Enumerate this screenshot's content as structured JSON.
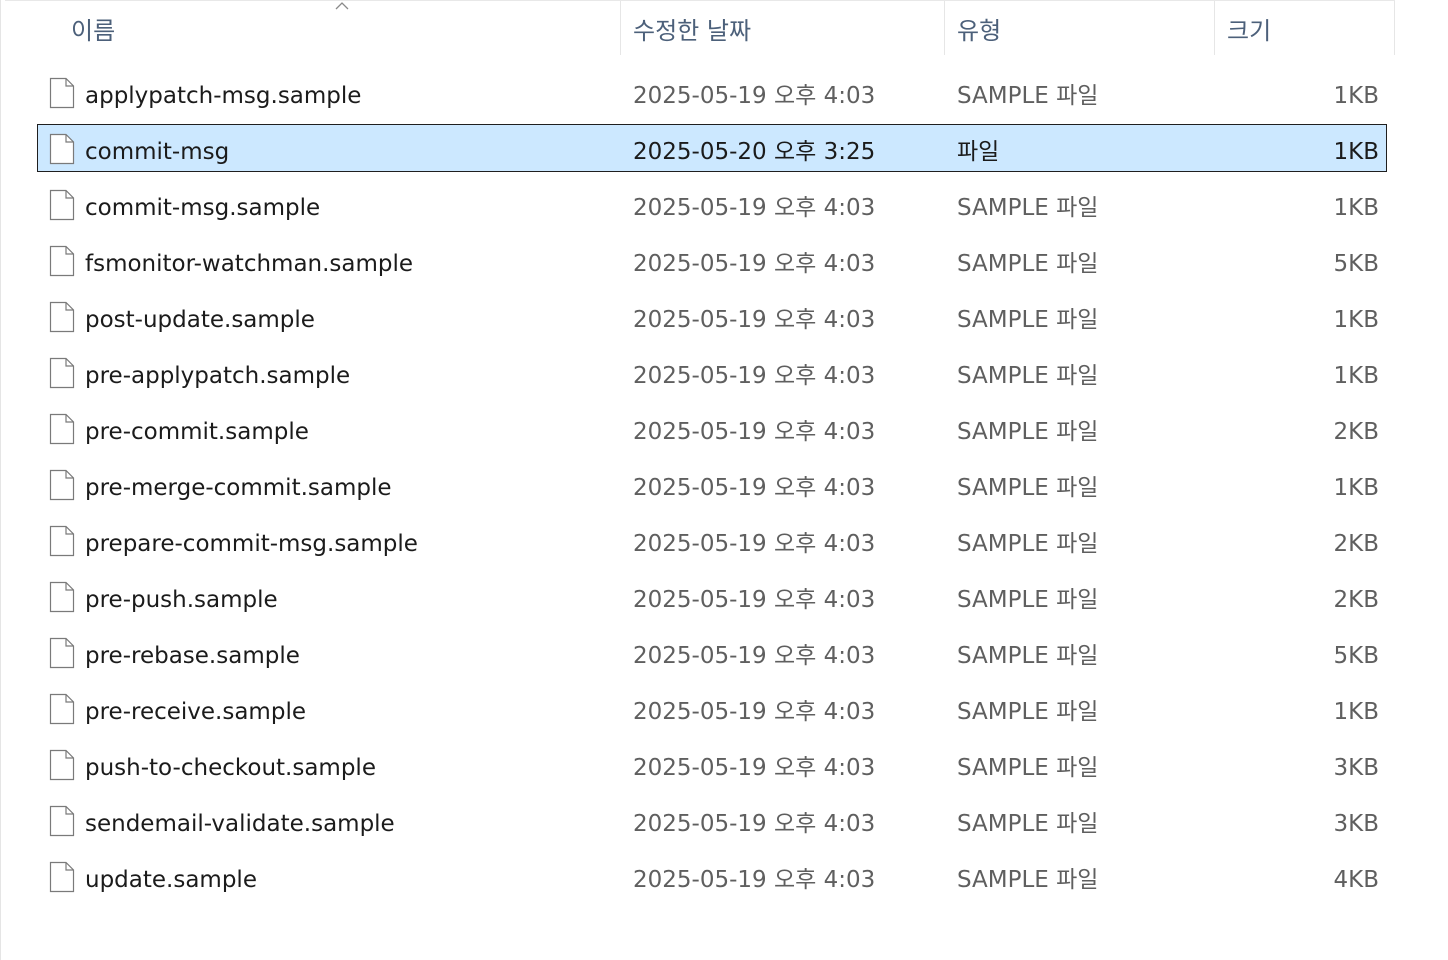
{
  "columns": {
    "name": "이름",
    "date": "수정한 날짜",
    "type": "유형",
    "size": "크기"
  },
  "sort": {
    "column": "name",
    "direction": "ascending"
  },
  "colors": {
    "selection": "#cce8ff",
    "header_text": "#4c607a"
  },
  "files": [
    {
      "name": "applypatch-msg.sample",
      "date": "2025-05-19 오후 4:03",
      "type": "SAMPLE 파일",
      "size": "1KB",
      "icon": "file-icon",
      "selected": false
    },
    {
      "name": "commit-msg",
      "date": "2025-05-20 오후 3:25",
      "type": "파일",
      "size": "1KB",
      "icon": "file-icon",
      "selected": true
    },
    {
      "name": "commit-msg.sample",
      "date": "2025-05-19 오후 4:03",
      "type": "SAMPLE 파일",
      "size": "1KB",
      "icon": "file-icon",
      "selected": false
    },
    {
      "name": "fsmonitor-watchman.sample",
      "date": "2025-05-19 오후 4:03",
      "type": "SAMPLE 파일",
      "size": "5KB",
      "icon": "file-icon",
      "selected": false
    },
    {
      "name": "post-update.sample",
      "date": "2025-05-19 오후 4:03",
      "type": "SAMPLE 파일",
      "size": "1KB",
      "icon": "file-icon",
      "selected": false
    },
    {
      "name": "pre-applypatch.sample",
      "date": "2025-05-19 오후 4:03",
      "type": "SAMPLE 파일",
      "size": "1KB",
      "icon": "file-icon",
      "selected": false
    },
    {
      "name": "pre-commit.sample",
      "date": "2025-05-19 오후 4:03",
      "type": "SAMPLE 파일",
      "size": "2KB",
      "icon": "file-icon",
      "selected": false
    },
    {
      "name": "pre-merge-commit.sample",
      "date": "2025-05-19 오후 4:03",
      "type": "SAMPLE 파일",
      "size": "1KB",
      "icon": "file-icon",
      "selected": false
    },
    {
      "name": "prepare-commit-msg.sample",
      "date": "2025-05-19 오후 4:03",
      "type": "SAMPLE 파일",
      "size": "2KB",
      "icon": "file-icon",
      "selected": false
    },
    {
      "name": "pre-push.sample",
      "date": "2025-05-19 오후 4:03",
      "type": "SAMPLE 파일",
      "size": "2KB",
      "icon": "file-icon",
      "selected": false
    },
    {
      "name": "pre-rebase.sample",
      "date": "2025-05-19 오후 4:03",
      "type": "SAMPLE 파일",
      "size": "5KB",
      "icon": "file-icon",
      "selected": false
    },
    {
      "name": "pre-receive.sample",
      "date": "2025-05-19 오후 4:03",
      "type": "SAMPLE 파일",
      "size": "1KB",
      "icon": "file-icon",
      "selected": false
    },
    {
      "name": "push-to-checkout.sample",
      "date": "2025-05-19 오후 4:03",
      "type": "SAMPLE 파일",
      "size": "3KB",
      "icon": "file-icon",
      "selected": false
    },
    {
      "name": "sendemail-validate.sample",
      "date": "2025-05-19 오후 4:03",
      "type": "SAMPLE 파일",
      "size": "3KB",
      "icon": "file-icon",
      "selected": false
    },
    {
      "name": "update.sample",
      "date": "2025-05-19 오후 4:03",
      "type": "SAMPLE 파일",
      "size": "4KB",
      "icon": "file-icon",
      "selected": false
    }
  ]
}
